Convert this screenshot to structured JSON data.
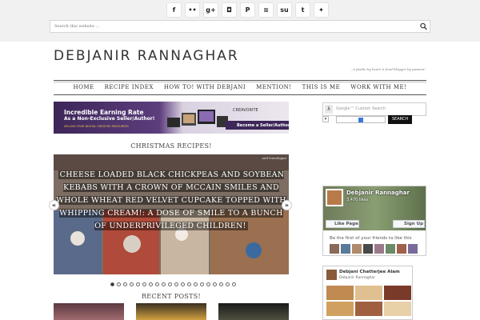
{
  "social_icons": [
    {
      "name": "facebook-icon",
      "glyph": "f"
    },
    {
      "name": "flickr-icon",
      "glyph": "••"
    },
    {
      "name": "google-plus-icon",
      "glyph": "g+"
    },
    {
      "name": "instagram-icon",
      "glyph": "◘"
    },
    {
      "name": "pinterest-icon",
      "glyph": "P"
    },
    {
      "name": "rss-icon",
      "glyph": "≋"
    },
    {
      "name": "stumbleupon-icon",
      "glyph": "su"
    },
    {
      "name": "tumblr-icon",
      "glyph": "t"
    },
    {
      "name": "twitter-icon",
      "glyph": "✦"
    }
  ],
  "search": {
    "placeholder": "Search this website …"
  },
  "site": {
    "title": "DEBJANIR RANNAGHAR",
    "tagline": "...a foodie by heart & food blogger by passion!"
  },
  "nav": {
    "items": [
      "HOME",
      "RECIPE INDEX",
      "HOW TO! WITH DEBJANI",
      "MENTION!",
      "THIS IS ME",
      "WORK WITH ME!"
    ]
  },
  "banner": {
    "line1": "Incredible Earning Rate",
    "line2": "As a Non-Exclusive Seller/Author!",
    "line3": "SELLING YOUR DIGITAL CREATIVE RESOURCES",
    "brand": "CREAVORITE",
    "cta": "Become a Seller/Author"
  },
  "slider": {
    "heading": "CHRISTMAS RECIPES!",
    "caption": "CHEESE LOADED BLACK CHICKPEAS AND SOYBEAN KEBABS WITH A CROWN OF MCCAIN SMILES AND WHOLE WHEAT RED VELVET CUPCAKE TOPPED WITH WHIPPING CREAM!: A DOSE OF SMILE TO A BUNCH OF UNDERPRIVILEGED CHILDREN!",
    "credit": "anil travelogue",
    "prev": "«",
    "next": "»",
    "slide_count": 20,
    "active_slide": 1
  },
  "recent_posts": {
    "heading": "RECENT POSTS!"
  },
  "translate": {
    "logo": "λ",
    "text": "Google™ Custom Search",
    "select_arrow": "▾",
    "button": "SEARCH"
  },
  "facebook": {
    "page_name": "Debjanir Rannaghar",
    "likes": "3,470 likes",
    "like_button": "Like Page",
    "signup_button": "Sign Up",
    "friends_text": "Be the first of your friends to like this"
  },
  "fbfeed": {
    "name": "Debjani Chatterjee Alam",
    "sub": "Debjanir Rannaghar"
  },
  "colors": {
    "topbar": "#f1f1f1",
    "banner_purple": "#3d2658",
    "search_button": "#111111"
  }
}
